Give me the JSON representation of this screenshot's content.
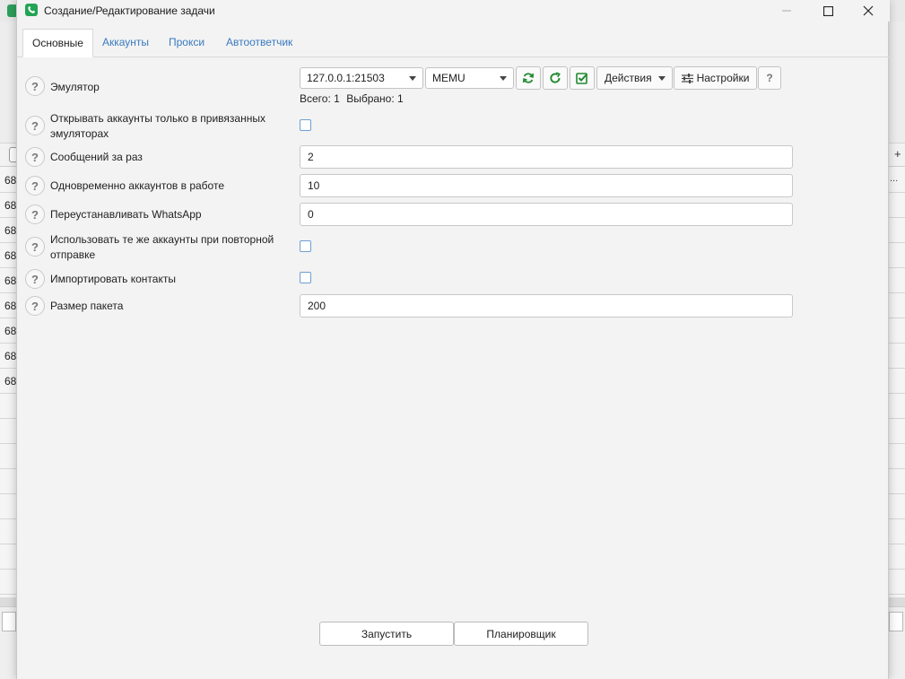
{
  "background_app": {
    "row_prefix": "68",
    "row_count": 9,
    "trailing_cell": "...",
    "add_symbol": "+"
  },
  "dialog": {
    "title": "Создание/Редактирование задачи",
    "tabs": [
      {
        "label": "Основные",
        "active": true
      },
      {
        "label": "Аккаунты",
        "active": false
      },
      {
        "label": "Прокси",
        "active": false
      },
      {
        "label": "Автоответчик",
        "active": false
      }
    ]
  },
  "emulator": {
    "label": "Эмулятор",
    "address_value": "127.0.0.1:21503",
    "type_value": "MEMU",
    "actions_label": "Действия",
    "settings_label": "Настройки",
    "help_symbol": "?",
    "total_label": "Всего:",
    "total_value": "1",
    "selected_label": "Выбрано:",
    "selected_value": "1"
  },
  "fields": {
    "bound_only": {
      "label": "Открывать аккаунты только в привязанных эмуляторах",
      "checked": false
    },
    "messages_per_run": {
      "label": "Сообщений за раз",
      "value": "2"
    },
    "accounts_concurrent": {
      "label": "Одновременно аккаунтов в работе",
      "value": "10"
    },
    "reinstall_whatsapp": {
      "label": "Переустанавливать WhatsApp",
      "value": "0"
    },
    "reuse_accounts": {
      "label": "Использовать те же аккаунты при повторной отправке",
      "checked": false
    },
    "import_contacts": {
      "label": "Импортировать контакты",
      "checked": false
    },
    "batch_size": {
      "label": "Размер пакета",
      "value": "200"
    }
  },
  "footer": {
    "start_label": "Запустить",
    "scheduler_label": "Планировщик"
  },
  "help_symbol": "?",
  "colors": {
    "accent_green": "#23a455",
    "tab_link": "#3a7abf",
    "checkbox_border": "#6c9fd4"
  }
}
